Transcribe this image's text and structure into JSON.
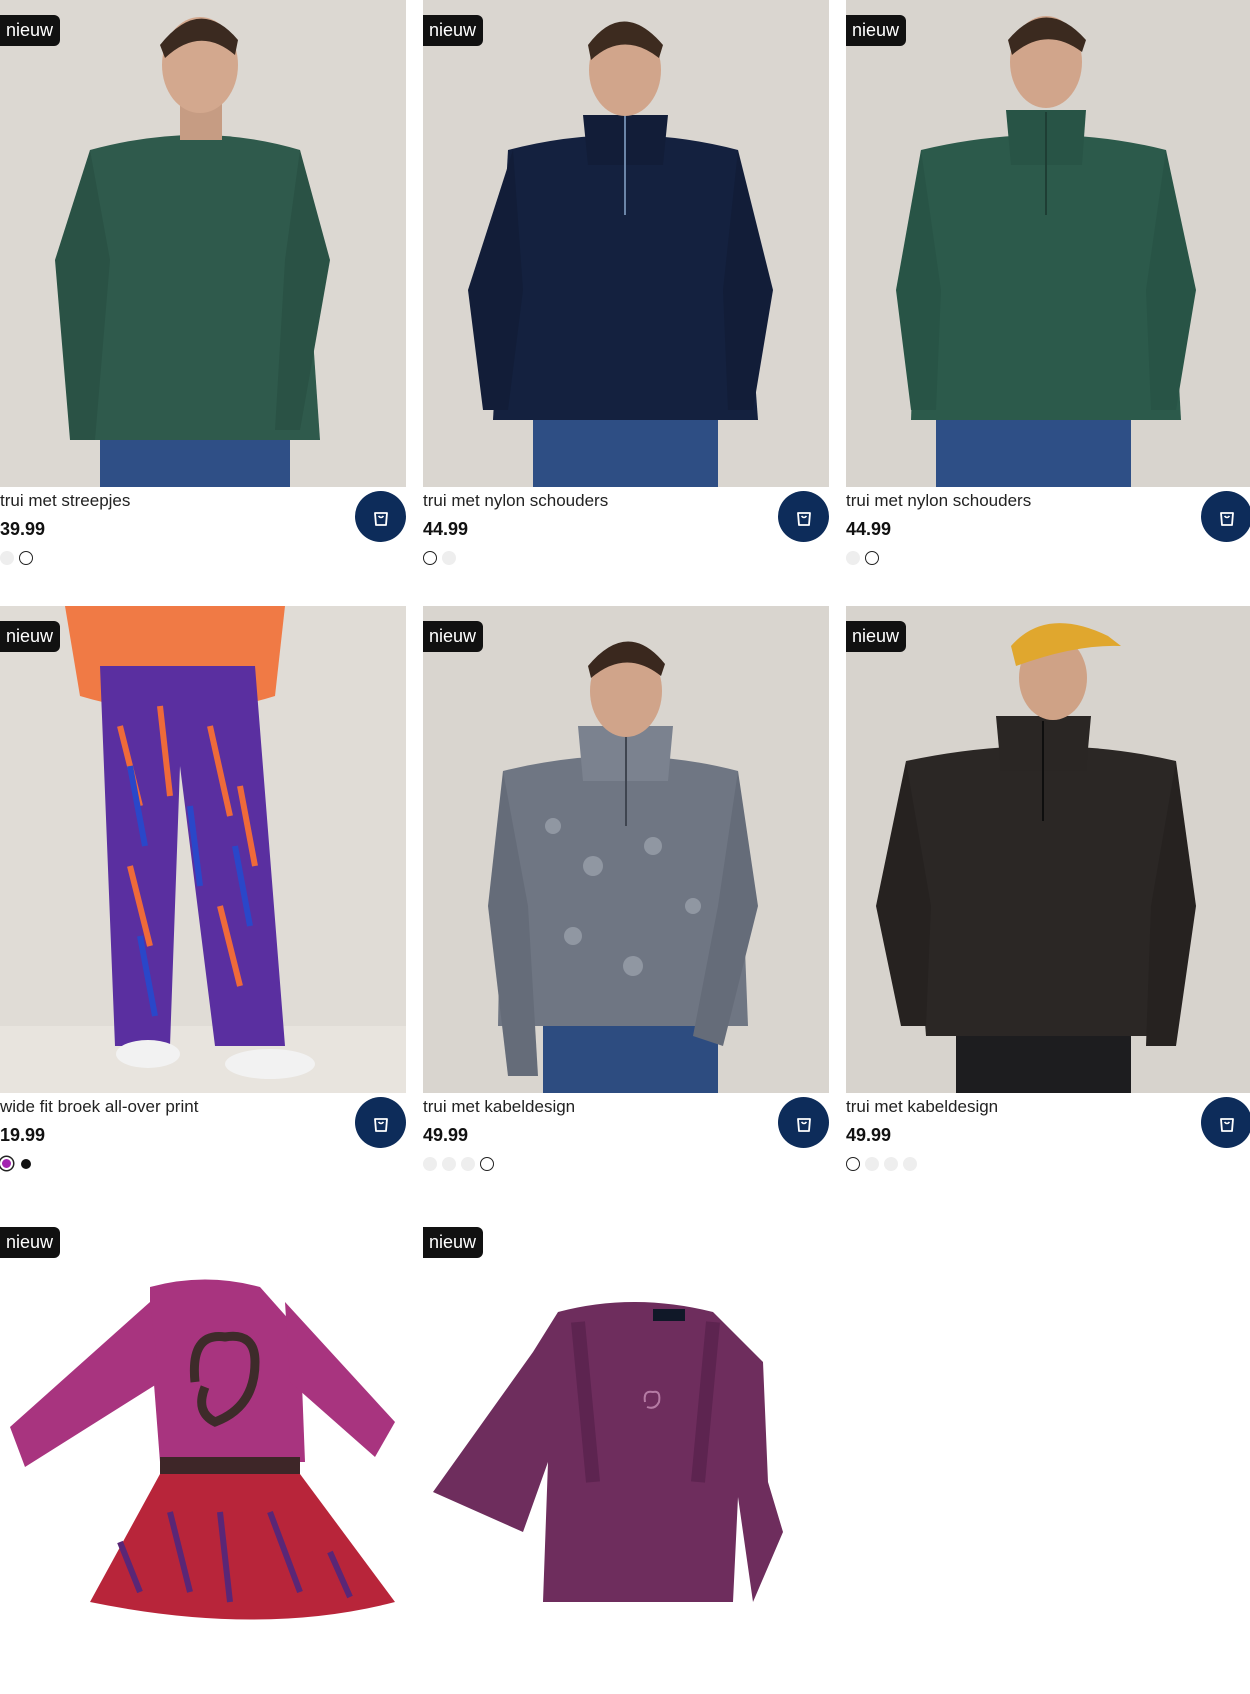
{
  "badge_label": "nieuw",
  "products": [
    {
      "title": "trui met streepjes",
      "price": "39.99"
    },
    {
      "title": "trui met nylon schouders",
      "price": "44.99"
    },
    {
      "title": "trui met nylon schouders",
      "price": "44.99"
    },
    {
      "title": "wide fit broek all-over print",
      "price": "19.99"
    },
    {
      "title": "trui met kabeldesign",
      "price": "49.99"
    },
    {
      "title": "trui met kabeldesign",
      "price": "49.99"
    },
    {
      "title": "",
      "price": ""
    },
    {
      "title": "",
      "price": ""
    }
  ],
  "icons": {
    "cart": "shopping-bag-icon"
  },
  "colors": {
    "accent": "#0d2c5a",
    "badge": "#111111"
  }
}
